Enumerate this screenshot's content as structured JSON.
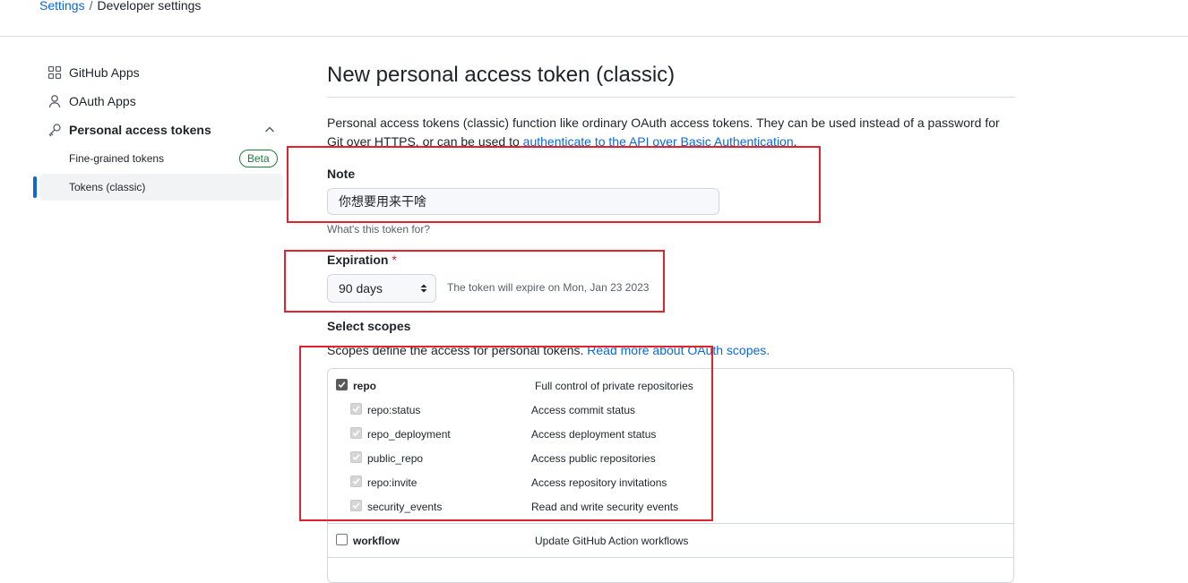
{
  "breadcrumb": {
    "settings": "Settings",
    "separator": "/",
    "current": "Developer settings"
  },
  "sidebar": {
    "items": [
      {
        "label": "GitHub Apps",
        "icon": "apps-icon"
      },
      {
        "label": "OAuth Apps",
        "icon": "person-icon"
      },
      {
        "label": "Personal access tokens",
        "icon": "key-icon",
        "expanded": true
      }
    ],
    "subitems": [
      {
        "label": "Fine-grained tokens",
        "badge": "Beta"
      },
      {
        "label": "Tokens (classic)",
        "active": true
      }
    ]
  },
  "main": {
    "title": "New personal access token (classic)",
    "description_prefix": "Personal access tokens (classic) function like ordinary OAuth access tokens. They can be used instead of a password for Git over HTTPS, or can be used to ",
    "description_link": "authenticate to the API over Basic Authentication",
    "description_suffix": ".",
    "note": {
      "label": "Note",
      "value": "你想要用来干啥",
      "hint": "What's this token for?"
    },
    "expiration": {
      "label": "Expiration",
      "required_mark": "*",
      "selected": "90 days",
      "note": "The token will expire on Mon, Jan 23 2023"
    },
    "scopes": {
      "label": "Select scopes",
      "description": "Scopes define the access for personal tokens. ",
      "link": "Read more about OAuth scopes.",
      "rows": [
        {
          "name": "repo",
          "desc": "Full control of private repositories",
          "checked": true,
          "child": false
        },
        {
          "name": "repo:status",
          "desc": "Access commit status",
          "checked": true,
          "child": true
        },
        {
          "name": "repo_deployment",
          "desc": "Access deployment status",
          "checked": true,
          "child": true
        },
        {
          "name": "public_repo",
          "desc": "Access public repositories",
          "checked": true,
          "child": true
        },
        {
          "name": "repo:invite",
          "desc": "Access repository invitations",
          "checked": true,
          "child": true
        },
        {
          "name": "security_events",
          "desc": "Read and write security events",
          "checked": true,
          "child": true
        },
        {
          "name": "workflow",
          "desc": "Update GitHub Action workflows",
          "checked": false,
          "child": false
        }
      ]
    }
  },
  "colors": {
    "accent": "#0969da",
    "highlight_box": "#e0232e",
    "beta_green": "#1a7f37"
  }
}
